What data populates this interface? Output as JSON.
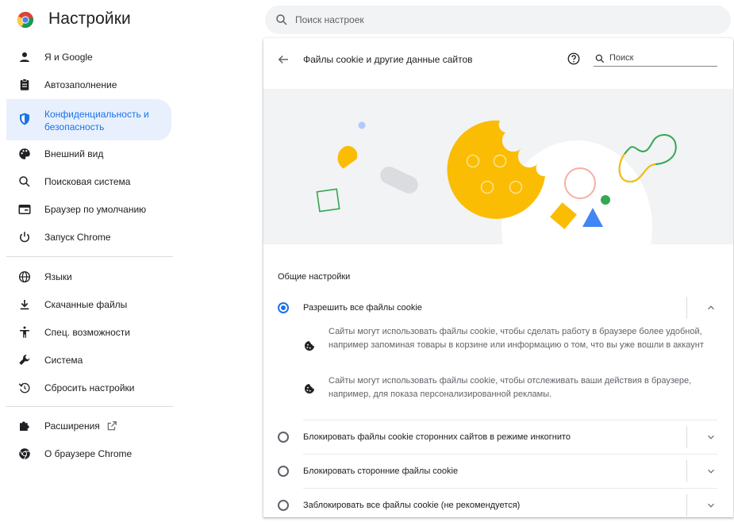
{
  "app": {
    "title": "Настройки"
  },
  "search": {
    "placeholder": "Поиск настроек"
  },
  "sidebar": {
    "items": [
      {
        "label": "Я и Google",
        "icon": "person-icon"
      },
      {
        "label": "Автозаполнение",
        "icon": "clipboard-icon"
      },
      {
        "label": "Конфиденциальность и безопасность",
        "icon": "shield-icon",
        "active": true
      },
      {
        "label": "Внешний вид",
        "icon": "palette-icon"
      },
      {
        "label": "Поисковая система",
        "icon": "search-icon"
      },
      {
        "label": "Браузер по умолчанию",
        "icon": "browser-icon"
      },
      {
        "label": "Запуск Chrome",
        "icon": "power-icon"
      },
      {
        "label": "Языки",
        "icon": "globe-icon"
      },
      {
        "label": "Скачанные файлы",
        "icon": "download-icon"
      },
      {
        "label": "Спец. возможности",
        "icon": "accessibility-icon"
      },
      {
        "label": "Система",
        "icon": "wrench-icon"
      },
      {
        "label": "Сбросить настройки",
        "icon": "reset-icon"
      },
      {
        "label": "Расширения",
        "icon": "puzzle-icon"
      },
      {
        "label": "О браузере Chrome",
        "icon": "chrome-icon"
      }
    ]
  },
  "page": {
    "title": "Файлы cookie и другие данные сайтов",
    "search_placeholder": "Поиск",
    "section_title": "Общие настройки",
    "options": [
      {
        "label": "Разрешить все файлы cookie",
        "selected": true,
        "expanded": true,
        "details": [
          "Сайты могут использовать файлы cookie, чтобы сделать работу в браузере более удобной, например запоминая товары в корзине или информацию о том, что вы уже вошли в аккаунт",
          "Сайты могут использовать файлы cookie, чтобы отслеживать ваши действия в браузере, например, для показа персонализированной рекламы."
        ]
      },
      {
        "label": "Блокировать файлы cookie сторонних сайтов в режиме инкогнито",
        "selected": false
      },
      {
        "label": "Блокировать сторонние файлы cookie",
        "selected": false
      },
      {
        "label": "Заблокировать все файлы cookie (не рекомендуется)",
        "selected": false
      }
    ]
  },
  "colors": {
    "accent": "#1a73e8",
    "active_bg": "#e8f0fe",
    "cookie_yellow": "#fbbc04",
    "green": "#34a853",
    "blue": "#4285f4",
    "pink": "#f6aea9"
  }
}
